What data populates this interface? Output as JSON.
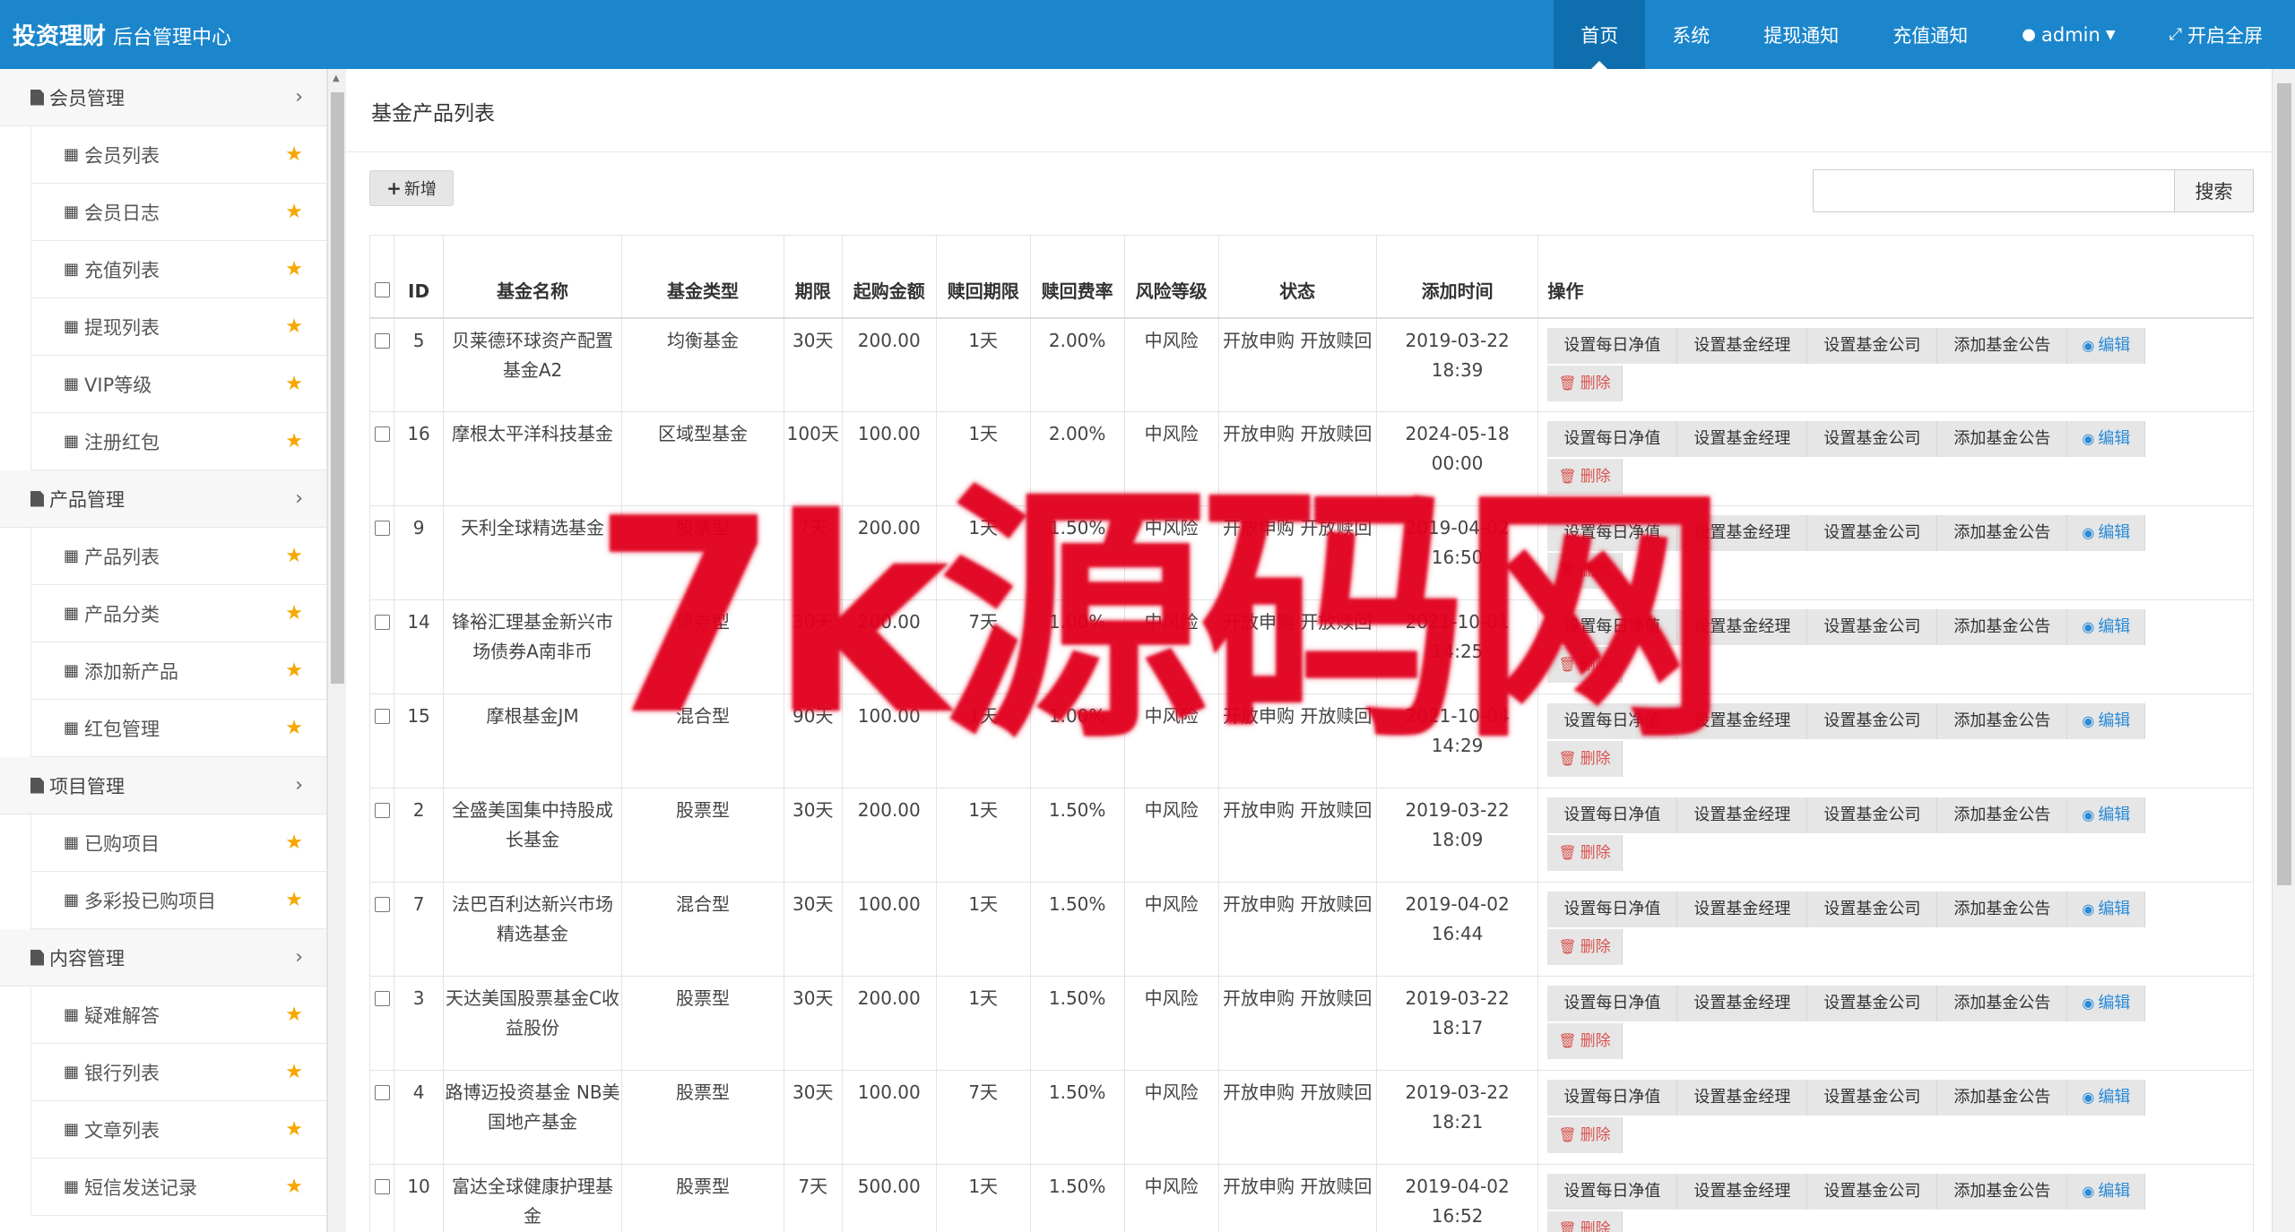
{
  "header": {
    "brand": "投资理财",
    "subtitle": "后台管理中心",
    "nav": [
      {
        "label": "首页",
        "active": true
      },
      {
        "label": "系统",
        "active": false
      },
      {
        "label": "提现通知",
        "active": false
      },
      {
        "label": "充值通知",
        "active": false
      }
    ],
    "user": "admin",
    "fullscreen": "开启全屏"
  },
  "sidebar": {
    "groups": [
      {
        "label": "会员管理",
        "items": [
          "会员列表",
          "会员日志",
          "充值列表",
          "提现列表",
          "VIP等级",
          "注册红包"
        ]
      },
      {
        "label": "产品管理",
        "items": [
          "产品列表",
          "产品分类",
          "添加新产品",
          "红包管理"
        ]
      },
      {
        "label": "项目管理",
        "items": [
          "已购项目",
          "多彩投已购项目"
        ]
      },
      {
        "label": "内容管理",
        "items": [
          "疑难解答",
          "银行列表",
          "文章列表",
          "短信发送记录"
        ]
      }
    ]
  },
  "main": {
    "title": "基金产品列表",
    "add_label": "新增",
    "search_label": "搜索",
    "search_value": "",
    "columns": [
      "ID",
      "基金名称",
      "基金类型",
      "期限",
      "起购金额",
      "赎回期限",
      "赎回费率",
      "风险等级",
      "状态",
      "添加时间",
      "操作"
    ],
    "actions": [
      "设置每日净值",
      "设置基金经理",
      "设置基金公司",
      "添加基金公告",
      "编辑",
      "删除"
    ],
    "rows": [
      {
        "id": "5",
        "name": "贝莱德环球资产配置基金A2",
        "type": "均衡基金",
        "term": "30天",
        "min": "200.00",
        "redeem": "1天",
        "fee": "2.00%",
        "risk": "中风险",
        "status": "开放申购 开放赎回",
        "date": "2019-03-22",
        "time": "18:39"
      },
      {
        "id": "16",
        "name": "摩根太平洋科技基金",
        "type": "区域型基金",
        "term": "100天",
        "min": "100.00",
        "redeem": "1天",
        "fee": "2.00%",
        "risk": "中风险",
        "status": "开放申购 开放赎回",
        "date": "2024-05-18",
        "time": "00:00"
      },
      {
        "id": "9",
        "name": "天利全球精选基金",
        "type": "股票型",
        "term": "7天",
        "min": "200.00",
        "redeem": "1天",
        "fee": "1.50%",
        "risk": "中风险",
        "status": "开放申购 开放赎回",
        "date": "2019-04-02",
        "time": "16:50"
      },
      {
        "id": "14",
        "name": "锋裕汇理基金新兴市场债券A南非币",
        "type": "债券型",
        "term": "30天",
        "min": "200.00",
        "redeem": "7天",
        "fee": "1.00%",
        "risk": "中风险",
        "status": "开放申购 开放赎回",
        "date": "2021-10-01",
        "time": "14:25"
      },
      {
        "id": "15",
        "name": "摩根基金JM",
        "type": "混合型",
        "term": "90天",
        "min": "100.00",
        "redeem": "1天",
        "fee": "1.00%",
        "risk": "中风险",
        "status": "开放申购 开放赎回",
        "date": "2021-10-04",
        "time": "14:29"
      },
      {
        "id": "2",
        "name": "全盛美国集中持股成长基金",
        "type": "股票型",
        "term": "30天",
        "min": "200.00",
        "redeem": "1天",
        "fee": "1.50%",
        "risk": "中风险",
        "status": "开放申购 开放赎回",
        "date": "2019-03-22",
        "time": "18:09"
      },
      {
        "id": "7",
        "name": "法巴百利达新兴市场精选基金",
        "type": "混合型",
        "term": "30天",
        "min": "100.00",
        "redeem": "1天",
        "fee": "1.50%",
        "risk": "中风险",
        "status": "开放申购 开放赎回",
        "date": "2019-04-02",
        "time": "16:44"
      },
      {
        "id": "3",
        "name": "天达美国股票基金C收益股份",
        "type": "股票型",
        "term": "30天",
        "min": "200.00",
        "redeem": "1天",
        "fee": "1.50%",
        "risk": "中风险",
        "status": "开放申购 开放赎回",
        "date": "2019-03-22",
        "time": "18:17"
      },
      {
        "id": "4",
        "name": "路博迈投资基金 NB美国地产基金",
        "type": "股票型",
        "term": "30天",
        "min": "100.00",
        "redeem": "7天",
        "fee": "1.50%",
        "risk": "中风险",
        "status": "开放申购 开放赎回",
        "date": "2019-03-22",
        "time": "18:21"
      },
      {
        "id": "10",
        "name": "富达全球健康护理基金",
        "type": "股票型",
        "term": "7天",
        "min": "500.00",
        "redeem": "1天",
        "fee": "1.50%",
        "risk": "中风险",
        "status": "开放申购 开放赎回",
        "date": "2019-04-02",
        "time": "16:52"
      }
    ]
  },
  "watermark": "7k源码网",
  "colors": {
    "header": "#1b86cc",
    "header_active": "#0f6fae",
    "star": "#f6a800",
    "edit": "#2a8bd8",
    "delete": "#d9534f",
    "watermark": "#e1001e"
  }
}
